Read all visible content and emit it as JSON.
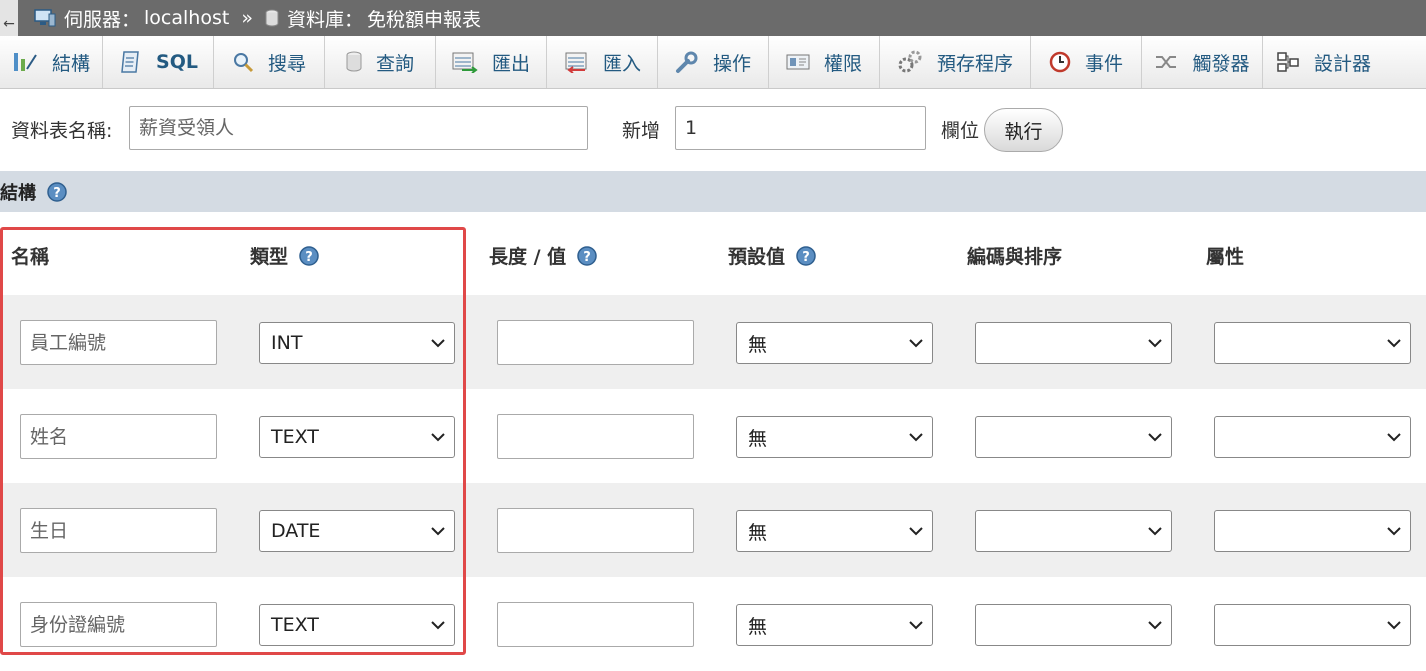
{
  "breadcrumb": {
    "back": "←",
    "server_label": "伺服器：",
    "server_value": "localhost",
    "separator": "»",
    "database_label": "資料庫：",
    "database_value": "免稅額申報表"
  },
  "tabs": [
    {
      "label": "結構",
      "icon": "structure-icon"
    },
    {
      "label": "SQL",
      "icon": "sql-icon"
    },
    {
      "label": "搜尋",
      "icon": "search-icon"
    },
    {
      "label": "查詢",
      "icon": "query-icon"
    },
    {
      "label": "匯出",
      "icon": "export-icon"
    },
    {
      "label": "匯入",
      "icon": "import-icon"
    },
    {
      "label": "操作",
      "icon": "wrench-icon"
    },
    {
      "label": "權限",
      "icon": "privileges-icon"
    },
    {
      "label": "預存程序",
      "icon": "routines-icon"
    },
    {
      "label": "事件",
      "icon": "clock-icon"
    },
    {
      "label": "觸發器",
      "icon": "triggers-icon"
    },
    {
      "label": "設計器",
      "icon": "designer-icon"
    }
  ],
  "form": {
    "table_name_label": "資料表名稱:",
    "table_name_placeholder": "薪資受領人",
    "add_label": "新增",
    "add_value": "1",
    "columns_label": "欄位",
    "execute_label": "執行"
  },
  "structure": {
    "title": "結構"
  },
  "table": {
    "headers": {
      "name": "名稱",
      "type": "類型",
      "length": "長度 / 值",
      "default": "預設值",
      "collation": "編碼與排序",
      "attributes": "屬性"
    },
    "rows": [
      {
        "name_placeholder": "員工編號",
        "type": "INT",
        "length": "",
        "default": "無",
        "collation": "",
        "attributes": ""
      },
      {
        "name_placeholder": "姓名",
        "type": "TEXT",
        "length": "",
        "default": "無",
        "collation": "",
        "attributes": ""
      },
      {
        "name_placeholder": "生日",
        "type": "DATE",
        "length": "",
        "default": "無",
        "collation": "",
        "attributes": ""
      },
      {
        "name_placeholder": "身份證編號",
        "type": "TEXT",
        "length": "",
        "default": "無",
        "collation": "",
        "attributes": ""
      }
    ]
  },
  "colors": {
    "breadcrumb_bg": "#6b6b6b",
    "tab_text": "#235a81",
    "structure_bar": "#d4dbe3",
    "highlight": "#e04848",
    "row_alt": "#efefef"
  }
}
